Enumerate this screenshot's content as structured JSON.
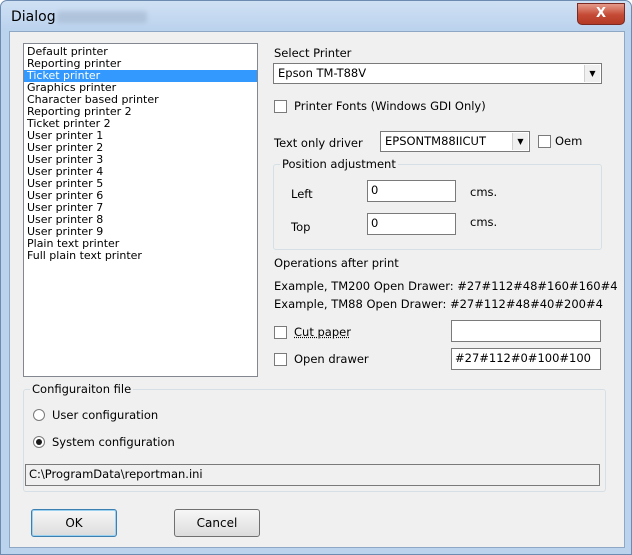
{
  "window": {
    "title": "Dialog",
    "close_glyph": "X"
  },
  "printers": {
    "items": [
      "Default printer",
      "Reporting printer",
      "Ticket printer",
      "Graphics printer",
      "Character based printer",
      "Reporting printer 2",
      "Ticket printer 2",
      "User printer 1",
      "User printer 2",
      "User printer 3",
      "User printer 4",
      "User printer 5",
      "User printer 6",
      "User printer 7",
      "User printer 8",
      "User printer 9",
      "Plain text printer",
      "Full plain text printer"
    ],
    "selected": "Ticket printer"
  },
  "select_printer": {
    "label": "Select Printer",
    "value": "Epson TM-T88V"
  },
  "printer_fonts": {
    "label": "Printer Fonts (Windows GDI Only)",
    "checked": false
  },
  "text_only_driver": {
    "label": "Text only driver",
    "value": "EPSONTM88IICUT",
    "oem_label": "Oem",
    "oem_checked": false
  },
  "position": {
    "title": "Position adjustment",
    "left_label": "Left",
    "left_value": "0",
    "top_label": "Top",
    "top_value": "0",
    "unit": "cms."
  },
  "operations": {
    "title": "Operations after print",
    "example1": "Example, TM200 Open Drawer: #27#112#48#160#160#4",
    "example2": "Example, TM88 Open Drawer: #27#112#48#40#200#4",
    "cut_paper_label": "Cut paper",
    "cut_paper_checked": false,
    "cut_paper_value": "",
    "open_drawer_label": "Open drawer",
    "open_drawer_checked": false,
    "open_drawer_value": "#27#112#0#100#100"
  },
  "config": {
    "title": "Configuraiton file",
    "user_label": "User configuration",
    "system_label": "System configuration",
    "selected": "system",
    "path": "C:\\ProgramData\\reportman.ini"
  },
  "buttons": {
    "ok": "OK",
    "cancel": "Cancel"
  },
  "colors": {
    "selection": "#3399ff",
    "dialog_bg": "#f0f0f0",
    "title_bar": "#bcd3ee",
    "close_button": "#c44a35"
  }
}
